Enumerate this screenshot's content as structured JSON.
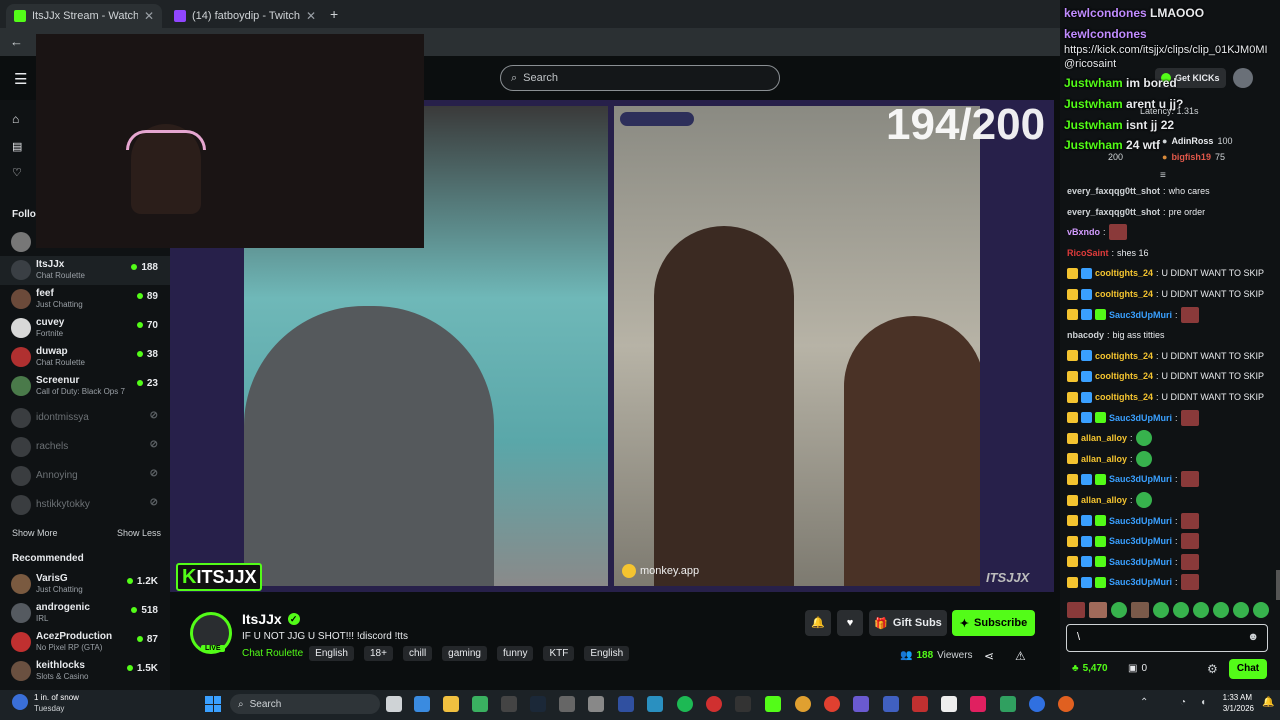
{
  "browser": {
    "tabs": [
      {
        "title": "ItsJJx Stream - Watch Live o",
        "icon_color": "#53fc18"
      },
      {
        "title": "(14) fatboydip - Twitch",
        "icon_color": "#9146ff"
      }
    ],
    "new_tab": "+"
  },
  "site": {
    "search_placeholder": "Search",
    "get_kicks": "Get KICKs",
    "latency": "Latency: 1.31s"
  },
  "sidebar": {
    "following_label": "Follow",
    "channels": [
      {
        "name": "ItsJJx",
        "category": "Chat Roulette",
        "viewers": "188",
        "avatar": "#3a3f44"
      },
      {
        "name": "feef",
        "category": "Just Chatting",
        "viewers": "89",
        "avatar": "#6b4a3a"
      },
      {
        "name": "cuvey",
        "category": "Fortnite",
        "viewers": "70",
        "avatar": "#d8d8d8"
      },
      {
        "name": "duwap",
        "category": "Chat Roulette",
        "viewers": "38",
        "avatar": "#b03030"
      },
      {
        "name": "Screenur",
        "category": "Call of Duty: Black Ops 7",
        "viewers": "23",
        "avatar": "#4a7a4a"
      }
    ],
    "offline": [
      "idontmissya",
      "rachels",
      "Annoying",
      "hstikkytokky"
    ],
    "show_more": "Show More",
    "show_less": "Show Less",
    "recommended_label": "Recommended",
    "recommended": [
      {
        "name": "VarisG",
        "category": "Just Chatting",
        "viewers": "1.2K",
        "avatar": "#7a5a40"
      },
      {
        "name": "androgenic",
        "category": "IRL",
        "viewers": "518",
        "avatar": "#555a60"
      },
      {
        "name": "AcezProduction",
        "category": "No Pixel RP (GTA)",
        "viewers": "87",
        "avatar": "#c03030"
      },
      {
        "name": "keithlocks",
        "category": "Slots & Casino",
        "viewers": "1.5K",
        "avatar": "#6a5040"
      }
    ]
  },
  "stream": {
    "counter": "194/200",
    "watermark": "ITSJJX",
    "partner_label": "monkey.app",
    "streamer": "ItsJJx",
    "live": "LIVE",
    "title": "IF U NOT JJG U SHOT!!!   !discord !tts",
    "category": "Chat Roulette",
    "tags": [
      "English",
      "18+",
      "chill",
      "gaming",
      "funny",
      "KTF",
      "English"
    ],
    "gift_subs": "Gift Subs",
    "subscribe": "Subscribe",
    "viewers": "188",
    "viewers_label": "Viewers",
    "banner_text": "ITSJJX"
  },
  "chat_overlay": [
    {
      "user": "kewlcondones",
      "text": "LMAOOO",
      "color": "#c08cff"
    },
    {
      "user": "kewlcondones",
      "text": "",
      "color": "#c08cff"
    },
    {
      "user": "",
      "text": "https://kick.com/itsjjx/clips/clip_01KJM0MI",
      "color": "#ffffff"
    },
    {
      "user": "",
      "text": "@ricosaint",
      "color": "#ffffff"
    },
    {
      "user": "Justwham",
      "text": "im bored",
      "color": "#53fc18"
    },
    {
      "user": "Justwham",
      "text": "arent u jj?",
      "color": "#53fc18"
    },
    {
      "user": "Justwham",
      "text": "isnt jj 22",
      "color": "#53fc18"
    },
    {
      "user": "Justwham",
      "text": "24 wtf",
      "color": "#53fc18"
    }
  ],
  "leaderboard": [
    {
      "name": "AdinRoss",
      "amount": "100"
    },
    {
      "name": "bigfish19",
      "amount": "75"
    }
  ],
  "leaderboard_self": "200",
  "chat": [
    {
      "user": "every_faxqqg0tt_shot",
      "text": "who cares",
      "color": "#cfd3d6",
      "badges": 0,
      "emote": ""
    },
    {
      "user": "every_faxqqg0tt_shot",
      "text": "pre order",
      "color": "#cfd3d6",
      "badges": 0,
      "emote": ""
    },
    {
      "user": "vBxndo",
      "text": "",
      "color": "#d39cff",
      "badges": 0,
      "emote": "pic"
    },
    {
      "user": "RicoSaint",
      "text": "shes 16",
      "color": "#e03b3b",
      "badges": 0,
      "emote": ""
    },
    {
      "user": "cooltights_24",
      "text": "U DIDNT WANT TO SKIP",
      "color": "#f4c430",
      "badges": 2,
      "emote": ""
    },
    {
      "user": "cooltights_24",
      "text": "U DIDNT WANT TO SKIP",
      "color": "#f4c430",
      "badges": 2,
      "emote": ""
    },
    {
      "user": "Sauc3dUpMuri",
      "text": "",
      "color": "#3aa0ff",
      "badges": 3,
      "emote": "pic"
    },
    {
      "user": "nbacody",
      "text": "big ass titties",
      "color": "#cfd3d6",
      "badges": 0,
      "emote": ""
    },
    {
      "user": "cooltights_24",
      "text": "U DIDNT WANT TO SKIP",
      "color": "#f4c430",
      "badges": 2,
      "emote": ""
    },
    {
      "user": "cooltights_24",
      "text": "U DIDNT WANT TO SKIP",
      "color": "#f4c430",
      "badges": 2,
      "emote": ""
    },
    {
      "user": "cooltights_24",
      "text": "U DIDNT WANT TO SKIP",
      "color": "#f4c430",
      "badges": 2,
      "emote": ""
    },
    {
      "user": "Sauc3dUpMuri",
      "text": "",
      "color": "#3aa0ff",
      "badges": 3,
      "emote": "pic"
    },
    {
      "user": "allan_alloy",
      "text": "",
      "color": "#f4c430",
      "badges": 1,
      "emote": "green"
    },
    {
      "user": "allan_alloy",
      "text": "",
      "color": "#f4c430",
      "badges": 1,
      "emote": "green"
    },
    {
      "user": "Sauc3dUpMuri",
      "text": "",
      "color": "#3aa0ff",
      "badges": 3,
      "emote": "pic"
    },
    {
      "user": "allan_alloy",
      "text": "",
      "color": "#f4c430",
      "badges": 1,
      "emote": "green"
    },
    {
      "user": "Sauc3dUpMuri",
      "text": "",
      "color": "#3aa0ff",
      "badges": 3,
      "emote": "pic"
    },
    {
      "user": "Sauc3dUpMuri",
      "text": "",
      "color": "#3aa0ff",
      "badges": 3,
      "emote": "pic"
    },
    {
      "user": "Sauc3dUpMuri",
      "text": "",
      "color": "#3aa0ff",
      "badges": 3,
      "emote": "pic"
    },
    {
      "user": "Sauc3dUpMuri",
      "text": "",
      "color": "#3aa0ff",
      "badges": 3,
      "emote": "pic"
    }
  ],
  "chat_input": {
    "value": "\\",
    "send": "Chat",
    "points": "5,470",
    "gifts": "0"
  },
  "taskbar": {
    "weather": "1 in. of snow",
    "weather_day": "Tuesday",
    "search": "Search",
    "time": "1:33 AM",
    "date": "3/1/2026"
  },
  "colors": {
    "kick_green": "#53fc18",
    "player_bg": "#27204a"
  }
}
